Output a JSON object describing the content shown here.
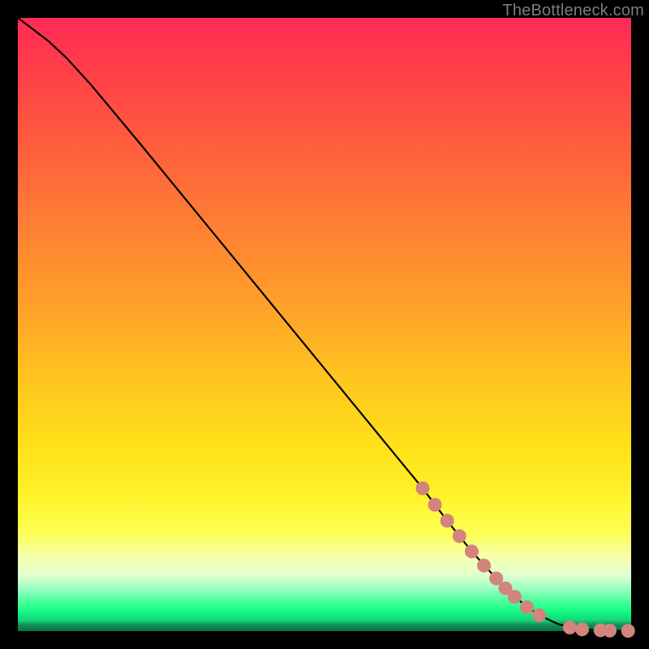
{
  "watermark": "TheBottleneck.com",
  "colors": {
    "line": "#000000",
    "marker_fill": "#d3847c",
    "marker_stroke": "#b65f56"
  },
  "chart_data": {
    "type": "line",
    "title": "",
    "xlabel": "",
    "ylabel": "",
    "xlim": [
      0,
      100
    ],
    "ylim": [
      0,
      100
    ],
    "series": [
      {
        "name": "curve",
        "x": [
          0.0,
          2.0,
          5.0,
          8.0,
          12.0,
          20.0,
          30.0,
          40.0,
          50.0,
          60.0,
          66.0,
          70.0,
          74.0,
          78.0,
          82.0,
          85.0,
          88.0,
          90.0,
          92.0,
          94.0,
          96.0,
          98.0,
          100.0
        ],
        "y": [
          100.0,
          98.5,
          96.2,
          93.4,
          89.0,
          79.4,
          67.2,
          55.0,
          42.8,
          30.6,
          23.3,
          18.0,
          13.0,
          8.6,
          4.8,
          2.6,
          1.2,
          0.6,
          0.3,
          0.2,
          0.1,
          0.05,
          0.05
        ]
      }
    ],
    "markers": {
      "name": "highlighted-points",
      "points": [
        {
          "x": 66.0,
          "y": 23.3
        },
        {
          "x": 68.0,
          "y": 20.6
        },
        {
          "x": 70.0,
          "y": 18.0
        },
        {
          "x": 72.0,
          "y": 15.5
        },
        {
          "x": 74.0,
          "y": 13.0
        },
        {
          "x": 76.0,
          "y": 10.7
        },
        {
          "x": 78.0,
          "y": 8.6
        },
        {
          "x": 79.5,
          "y": 7.0
        },
        {
          "x": 81.0,
          "y": 5.6
        },
        {
          "x": 83.0,
          "y": 3.9
        },
        {
          "x": 85.0,
          "y": 2.6
        },
        {
          "x": 90.0,
          "y": 0.6
        },
        {
          "x": 92.0,
          "y": 0.3
        },
        {
          "x": 95.0,
          "y": 0.15
        },
        {
          "x": 96.5,
          "y": 0.1
        },
        {
          "x": 99.5,
          "y": 0.05
        }
      ]
    }
  }
}
